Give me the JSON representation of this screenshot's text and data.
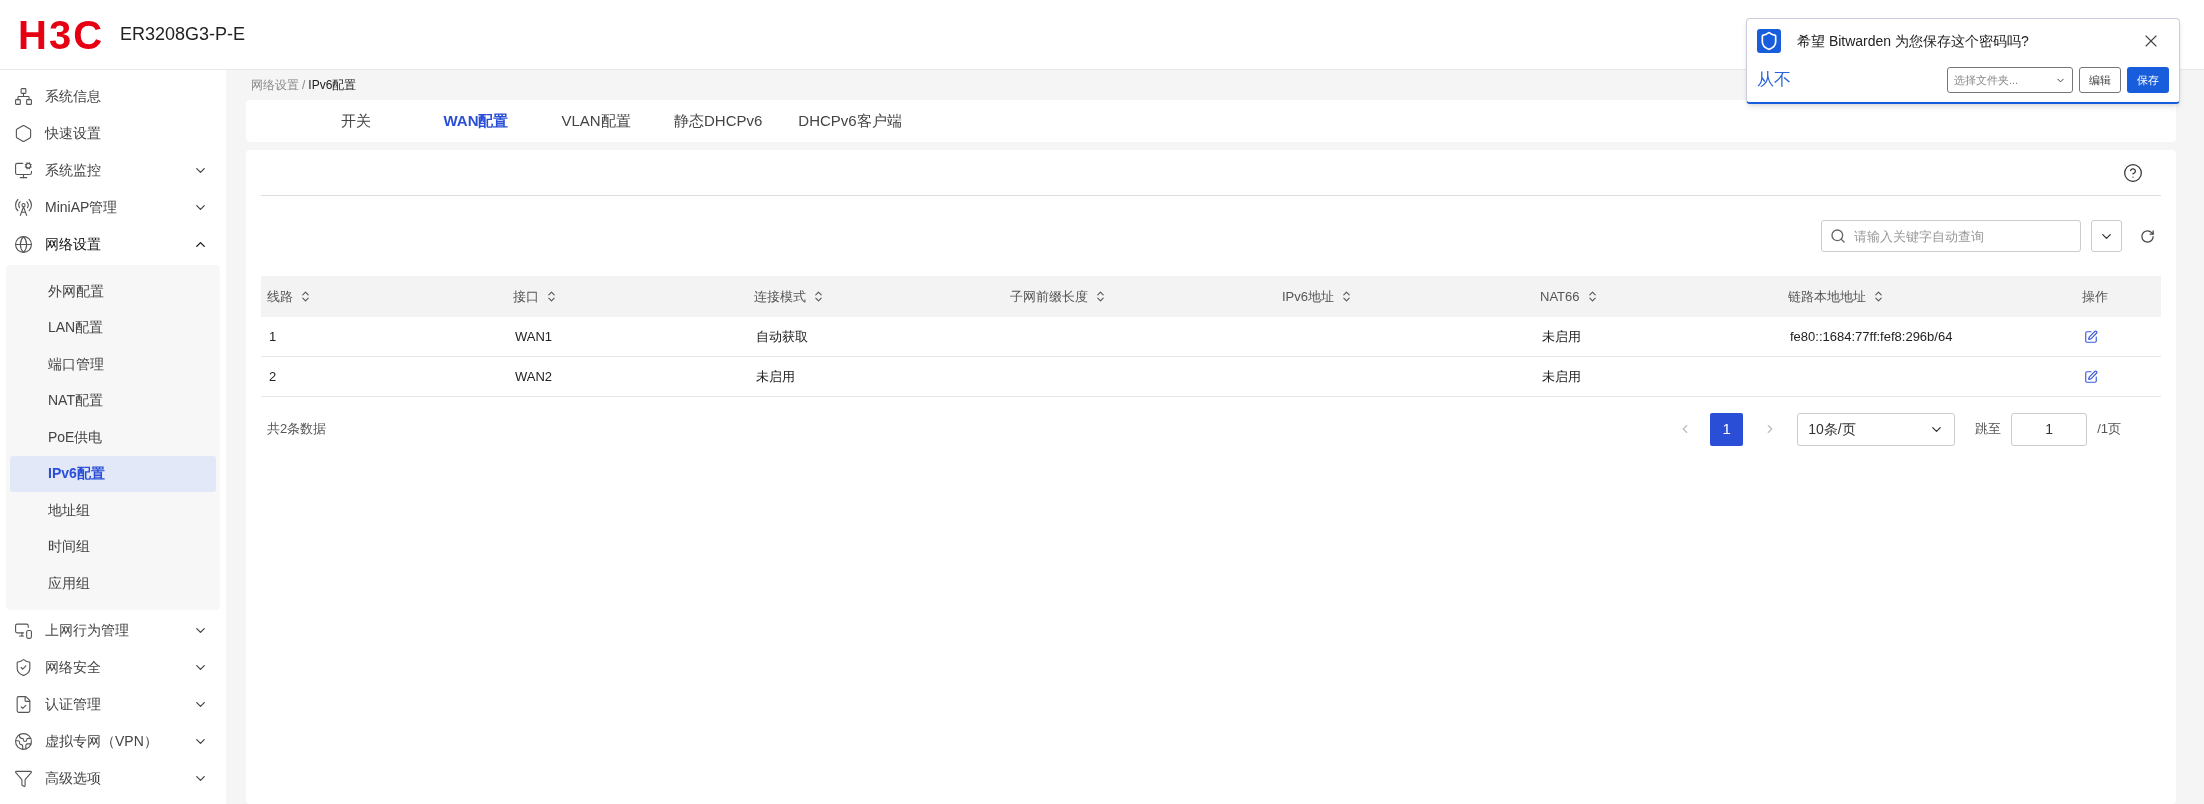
{
  "header": {
    "logo": "H3C",
    "model": "ER3208G3-P-E"
  },
  "sidebar": {
    "items": [
      {
        "label": "系统信息",
        "kind": "link"
      },
      {
        "label": "快速设置",
        "kind": "link"
      },
      {
        "label": "系统监控",
        "kind": "group",
        "expanded": false
      },
      {
        "label": "MiniAP管理",
        "kind": "group",
        "expanded": false
      },
      {
        "label": "网络设置",
        "kind": "group",
        "expanded": true,
        "children": [
          {
            "label": "外网配置",
            "selected": false
          },
          {
            "label": "LAN配置",
            "selected": false
          },
          {
            "label": "端口管理",
            "selected": false
          },
          {
            "label": "NAT配置",
            "selected": false
          },
          {
            "label": "PoE供电",
            "selected": false
          },
          {
            "label": "IPv6配置",
            "selected": true
          },
          {
            "label": "地址组",
            "selected": false
          },
          {
            "label": "时间组",
            "selected": false
          },
          {
            "label": "应用组",
            "selected": false
          }
        ]
      },
      {
        "label": "上网行为管理",
        "kind": "group",
        "expanded": false
      },
      {
        "label": "网络安全",
        "kind": "group",
        "expanded": false
      },
      {
        "label": "认证管理",
        "kind": "group",
        "expanded": false
      },
      {
        "label": "虚拟专网（VPN）",
        "kind": "group",
        "expanded": false
      },
      {
        "label": "高级选项",
        "kind": "group",
        "expanded": false
      }
    ]
  },
  "breadcrumb": {
    "items": [
      "网络设置",
      "IPv6配置"
    ],
    "separator": "/"
  },
  "tabs": [
    {
      "label": "开关",
      "selected": false
    },
    {
      "label": "WAN配置",
      "selected": true
    },
    {
      "label": "VLAN配置",
      "selected": false
    },
    {
      "label": "静态DHCPv6",
      "selected": false
    },
    {
      "label": "DHCPv6客户端",
      "selected": false
    }
  ],
  "search": {
    "placeholder": "请输入关键字自动查询"
  },
  "table": {
    "columns": [
      {
        "label": "线路",
        "sortable": true
      },
      {
        "label": "接口",
        "sortable": true
      },
      {
        "label": "连接模式",
        "sortable": true
      },
      {
        "label": "子网前缀长度",
        "sortable": true
      },
      {
        "label": "IPv6地址",
        "sortable": true
      },
      {
        "label": "NAT66",
        "sortable": true
      },
      {
        "label": "链路本地地址",
        "sortable": true
      },
      {
        "label": "操作",
        "sortable": false
      }
    ],
    "rows": [
      {
        "line": "1",
        "iface": "WAN1",
        "mode": "自动获取",
        "nat66": "未启用",
        "link_local": "fe80::1684:77ff:fef8:296b/64"
      },
      {
        "line": "2",
        "iface": "WAN2",
        "mode": "未启用",
        "nat66": "未启用"
      }
    ]
  },
  "footer": {
    "total": "共2条数据",
    "pages": [
      {
        "label": "1",
        "selected": true
      }
    ],
    "page_size": "10条/页",
    "jump_label": "跳至",
    "jump_value": "1",
    "total_pages": "/1页"
  },
  "popup": {
    "title": "希望 Bitwarden 为您保存这个密码吗?",
    "never": "从不",
    "folder": {
      "placeholder": "选择文件夹..."
    },
    "edit": "编辑",
    "save": "保存"
  }
}
